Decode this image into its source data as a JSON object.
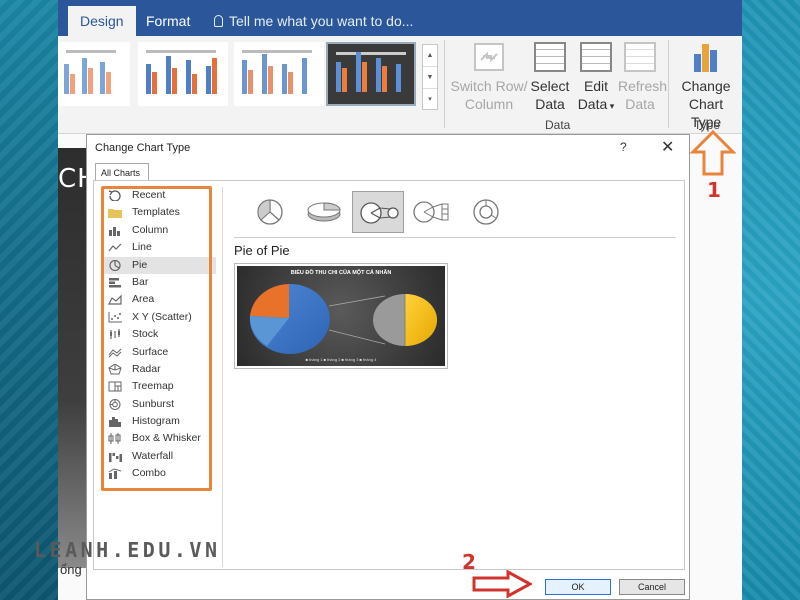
{
  "ribbon": {
    "tabs": [
      {
        "label": "Design",
        "active": true
      },
      {
        "label": "Format",
        "active": false
      }
    ],
    "tell_me": "Tell me what you want to do...",
    "data_group": {
      "label": "Data",
      "buttons": [
        {
          "line1": "Switch Row/",
          "line2": "Column",
          "enabled": false
        },
        {
          "line1": "Select",
          "line2": "Data",
          "enabled": true
        },
        {
          "line1": "Edit",
          "line2": "Data",
          "enabled": true
        },
        {
          "line1": "Refresh",
          "line2": "Data",
          "enabled": false
        }
      ]
    },
    "type_group": {
      "label": "Type",
      "change_line1": "Change",
      "change_line2": "Chart Type"
    }
  },
  "document": {
    "heading_fragment": "CH",
    "body_fragment": "ổng"
  },
  "dialog": {
    "title": "Change Chart Type",
    "help": "?",
    "close": "✕",
    "tab": "All Charts",
    "chart_types": [
      {
        "label": "Recent",
        "icon": "recent-icon"
      },
      {
        "label": "Templates",
        "icon": "folder-icon"
      },
      {
        "label": "Column",
        "icon": "column-chart-icon"
      },
      {
        "label": "Line",
        "icon": "line-chart-icon"
      },
      {
        "label": "Pie",
        "icon": "pie-chart-icon",
        "selected": true
      },
      {
        "label": "Bar",
        "icon": "bar-chart-icon"
      },
      {
        "label": "Area",
        "icon": "area-chart-icon"
      },
      {
        "label": "X Y (Scatter)",
        "icon": "scatter-chart-icon"
      },
      {
        "label": "Stock",
        "icon": "stock-chart-icon"
      },
      {
        "label": "Surface",
        "icon": "surface-chart-icon"
      },
      {
        "label": "Radar",
        "icon": "radar-chart-icon"
      },
      {
        "label": "Treemap",
        "icon": "treemap-chart-icon"
      },
      {
        "label": "Sunburst",
        "icon": "sunburst-chart-icon"
      },
      {
        "label": "Histogram",
        "icon": "histogram-chart-icon"
      },
      {
        "label": "Box & Whisker",
        "icon": "box-whisker-chart-icon"
      },
      {
        "label": "Waterfall",
        "icon": "waterfall-chart-icon"
      },
      {
        "label": "Combo",
        "icon": "combo-chart-icon"
      }
    ],
    "subtypes": [
      {
        "icon": "pie-icon",
        "selected": false
      },
      {
        "icon": "3d-pie-icon",
        "selected": false
      },
      {
        "icon": "pie-of-pie-icon",
        "selected": true
      },
      {
        "icon": "bar-of-pie-icon",
        "selected": false
      },
      {
        "icon": "doughnut-icon",
        "selected": false
      }
    ],
    "selected_subtype_name": "Pie of Pie",
    "preview": {
      "title": "BIỂU ĐỒ THU CHI CỦA MỘT CÁ NHÂN",
      "legend": "■ tháng 1   ■ tháng 2   ■ tháng 3   ■ tháng 4"
    },
    "ok_label": "OK",
    "cancel_label": "Cancel"
  },
  "annotations": {
    "step1": "1",
    "step2": "2",
    "watermark": "LEANH.EDU.VN"
  },
  "colors": {
    "ribbon_blue": "#2b579a",
    "annotation_orange": "#e8853a",
    "annotation_red": "#d0342c"
  }
}
